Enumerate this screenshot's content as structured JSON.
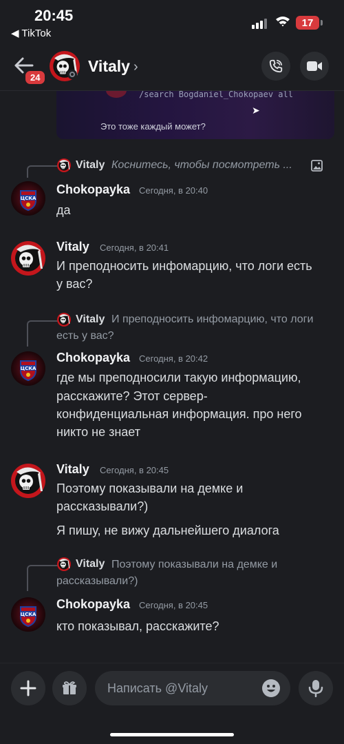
{
  "status_bar": {
    "time": "20:45",
    "back_app": "◀ TikTok",
    "battery": "17"
  },
  "header": {
    "badge": "24",
    "name": "Vitaly",
    "chevron": "›"
  },
  "embed": {
    "command": "/search Bogdaniel_Chokopaev all",
    "text": "Это тоже каждый может?"
  },
  "messages": [
    {
      "reply": {
        "author": "Vitaly",
        "text": "Коснитесь, чтобы посмотреть ...",
        "icon": "image-icon"
      },
      "author": "Chokopayka",
      "time": "Сегодня, в 20:40",
      "lines": [
        "да"
      ]
    },
    {
      "author": "Vitaly",
      "time": "Сегодня, в 20:41",
      "lines": [
        "И преподносить инфомарцию, что логи есть",
        "у вас?"
      ]
    },
    {
      "reply": {
        "author": "Vitaly",
        "text1": "И преподносить инфомарцию, что логи",
        "text2": "есть у вас?"
      },
      "author": "Chokopayka",
      "time": "Сегодня, в 20:42",
      "lines": [
        "где мы преподносили такую информацию,",
        "расскажите? Этот сервер-",
        "конфиденциальная информация. про него",
        "никто не знает"
      ]
    },
    {
      "author": "Vitaly",
      "time": "Сегодня, в 20:45",
      "lines": [
        "Поэтому показывали на демке и",
        "рассказывали?)"
      ],
      "extra": "Я пишу, не вижу дальнейшего диалога"
    },
    {
      "reply": {
        "author": "Vitaly",
        "text1": "Поэтому показывали на демке и",
        "text2": "рассказывали?)"
      },
      "author": "Chokopayka",
      "time": "Сегодня, в 20:45",
      "lines": [
        "кто показывал, расскажите?"
      ]
    }
  ],
  "composer": {
    "placeholder": "Написать @Vitaly"
  },
  "colors": {
    "background": "#1c1d21",
    "accent_red": "#d83a3d",
    "avatar_red": "#c4161c"
  }
}
